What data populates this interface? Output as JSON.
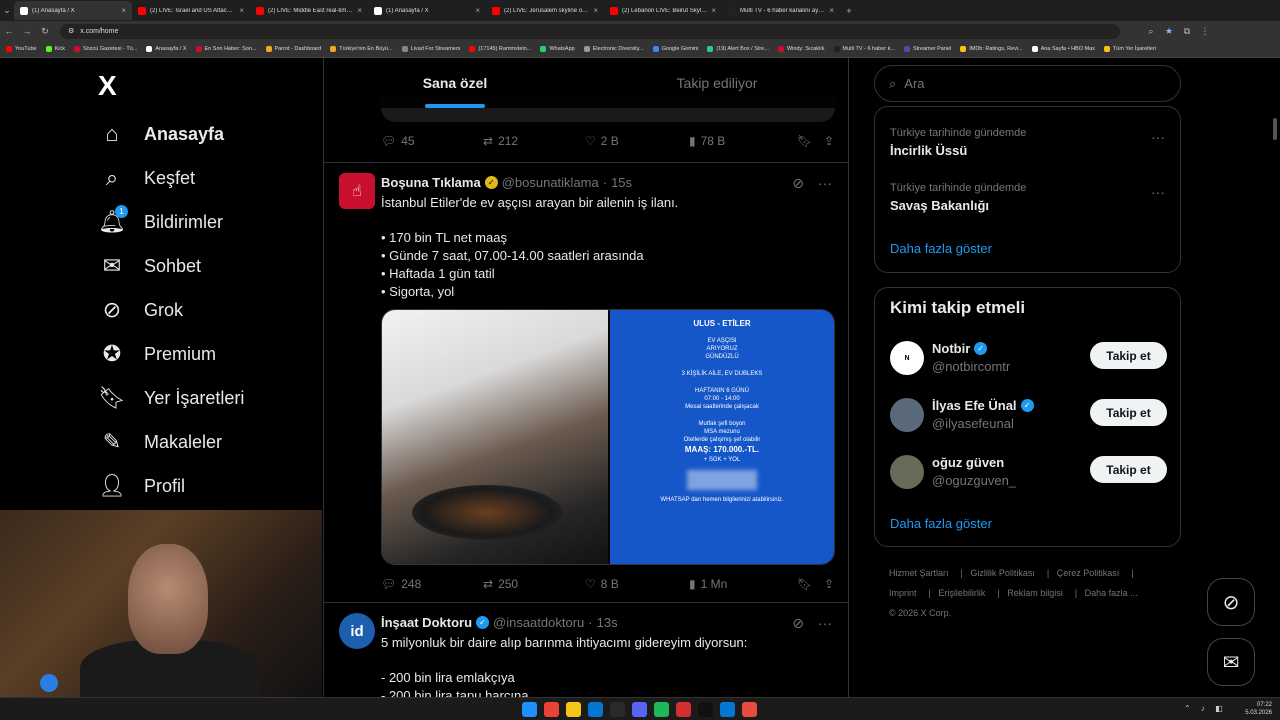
{
  "browser": {
    "tabs": [
      {
        "title": "(1) Anasayfa / X",
        "color": "#ffffff",
        "active": true
      },
      {
        "title": "(2) LIVE: Israel and US Attack Ir...",
        "color": "#ff0000"
      },
      {
        "title": "(2) LIVE: Middle East real-time ...",
        "color": "#ff0000"
      },
      {
        "title": "(1) Anasayfa / X",
        "color": "#ffffff"
      },
      {
        "title": "(2) LIVE: Jerusalem skyline on D...",
        "color": "#ff0000"
      },
      {
        "title": "(2) Lebanon LIVE: Beirut Skylin...",
        "color": "#ff0000"
      },
      {
        "title": "Multi TV - 6 haber kanalını aynı...",
        "color": "#222222"
      }
    ],
    "address": "x.com/home",
    "bookmarks": [
      "YouTube",
      "Kick",
      "Sözcü Gazetesi - Tü...",
      "Anasayfa / X",
      "En Son Haber: Son...",
      "Parrot - Dashboard",
      "Türkiye'nin En Büyü...",
      "Livad For Streamers",
      "(17145) Rammstein...",
      "WhatsApp",
      "Electronic Diversity...",
      "Google Gemini",
      "(19) Alert Box / Stre...",
      "Windy: Sıcaklık",
      "Multi TV - 6 haber k...",
      "Streamer Panel",
      "IMDb: Ratings, Revi...",
      "Ana Sayfa • HBO Max",
      "Tüm Yer İşaretleri"
    ]
  },
  "nav": {
    "logo": "X",
    "items": [
      {
        "label": "Anasayfa",
        "icon": "home-icon"
      },
      {
        "label": "Keşfet",
        "icon": "search-icon"
      },
      {
        "label": "Bildirimler",
        "icon": "bell-icon",
        "badge": "1"
      },
      {
        "label": "Sohbet",
        "icon": "mail-icon"
      },
      {
        "label": "Grok",
        "icon": "grok-icon"
      },
      {
        "label": "Premium",
        "icon": "premium-icon"
      },
      {
        "label": "Yer İşaretleri",
        "icon": "bookmark-icon"
      },
      {
        "label": "Makaleler",
        "icon": "article-icon"
      },
      {
        "label": "Profil",
        "icon": "profile-icon"
      }
    ]
  },
  "timeline": {
    "tabs": [
      "Sana özel",
      "Takip ediliyor"
    ],
    "prev_actions": {
      "replies": "45",
      "reposts": "212",
      "likes": "2 B",
      "views": "78 B"
    },
    "posts": [
      {
        "name": "Boşuna Tıklama",
        "handle": "@bosunatiklama",
        "time": "15s",
        "verified_color": "#e2b719",
        "avatar_color": "#c8102e",
        "text": "İstanbul Etiler'de ev aşçısı arayan bir ailenin iş ilanı.\n\n• 170 bin TL net maaş\n• Günde 7 saat, 07.00-14.00 saatleri arasında\n• Haftada 1 gün tatil\n• Sigorta, yol",
        "flyer": [
          "ULUS - ETİLER",
          "EV AŞÇISI",
          "ARIYORUZ",
          "GÜNDÜZLÜ",
          "3 KİŞİLİK AİLE,  EV DUBLEKS",
          "HAFTANIN 6 GÜNÜ",
          "07:00 - 14:00",
          "Mesai saatlerinde çalışacak",
          "Mutfak şefi boyon",
          "MSA mezunu",
          "Otellerde çalışmış şef olabilir",
          "MAAŞ: 170.000.-TL.",
          "+ SGK + YOL",
          "WHATSAP dan hemen bilgilerinizi atabilirsiniz."
        ],
        "actions": {
          "replies": "248",
          "reposts": "250",
          "likes": "8 B",
          "views": "1 Mn"
        }
      },
      {
        "name": "İnşaat Doktoru",
        "handle": "@insaatdoktoru",
        "time": "13s",
        "verified_color": "#1d9bf0",
        "avatar_color": "#1b5fae",
        "avatar_text": "id",
        "text": "5 milyonluk bir daire alıp barınma ihtiyacımı gidereyim diyorsun:\n\n- 200 bin lira emlakçıya\n- 200 bin lira tapu harcına"
      }
    ]
  },
  "sidebar": {
    "search_placeholder": "Ara",
    "trends": [
      {
        "meta": "Türkiye tarihinde gündemde",
        "name": "İncirlik Üssü"
      },
      {
        "meta": "Türkiye tarihinde gündemde",
        "name": "Savaş Bakanlığı"
      }
    ],
    "show_more": "Daha fazla göster",
    "who_title": "Kimi takip etmeli",
    "who": [
      {
        "name": "Notbir",
        "handle": "@notbircomtr",
        "avatar_color": "#ffffff"
      },
      {
        "name": "İlyas Efe Ünal",
        "handle": "@ilyasefeunal",
        "avatar_color": "#5a6a7a"
      },
      {
        "name": "oğuz güven",
        "handle": "@oguzguven_",
        "avatar_color": "#6a6a5a"
      }
    ],
    "follow_label": "Takip et",
    "footer": [
      "Hizmet Şartları",
      "Gizlilik Politikası",
      "Çerez Politikası",
      "Imprint",
      "Erişilebilirlik",
      "Reklam bilgisi",
      "Daha fazla ...",
      "© 2026 X Corp."
    ]
  },
  "taskbar": {
    "time": "07:22",
    "date": "5.03.2026"
  }
}
